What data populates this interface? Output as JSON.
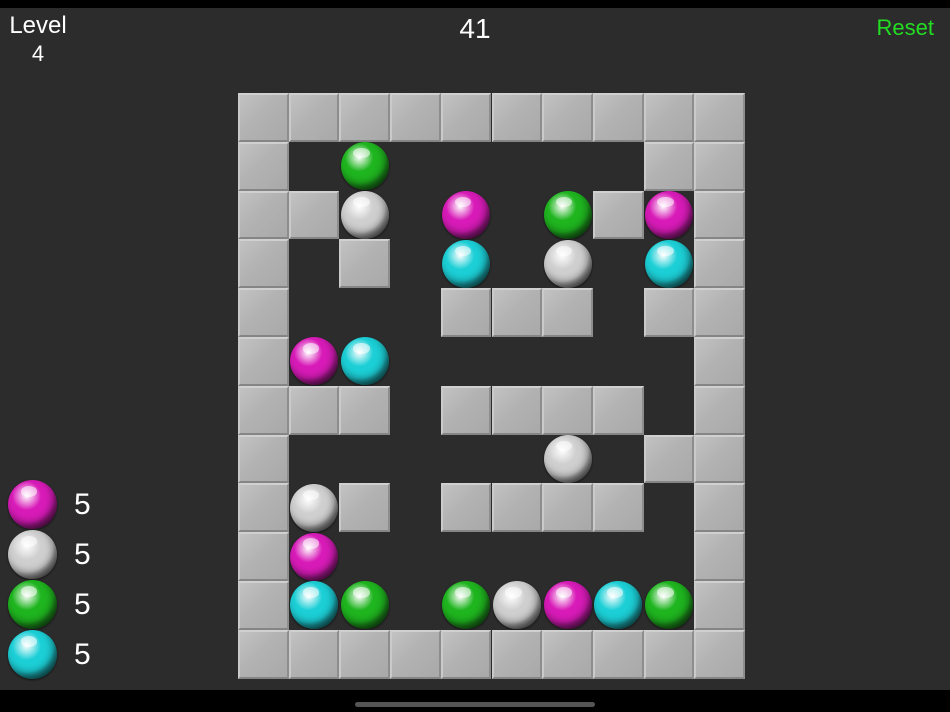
{
  "header": {
    "level_label": "Level",
    "level_value": "4",
    "moves": "41",
    "reset_label": "Reset"
  },
  "colors": {
    "background": "#2c2c2c",
    "reset": "#22dd22",
    "magenta": "#d81bb8",
    "white": "#cfcfcf",
    "green": "#1fb51f",
    "cyan": "#1ccfd6",
    "wall": "#b2b2b2"
  },
  "board": {
    "columns": 10,
    "rows": 12,
    "grid": [
      "##########",
      "#.G.....##",
      "##W.M.G#M#",
      "#.#.C.W.C#",
      "#...###.##",
      "#MC......#",
      "###.####.#",
      "#.....W.##",
      "#W#.####.#",
      "#M.......#",
      "#CG.GWMCG#",
      "##########"
    ],
    "legend": {
      "#": "wall",
      ".": "empty",
      "M": "magenta",
      "W": "white",
      "G": "green",
      "C": "cyan"
    }
  },
  "ball_counts": [
    {
      "color": "magenta",
      "count": "5"
    },
    {
      "color": "white",
      "count": "5"
    },
    {
      "color": "green",
      "count": "5"
    },
    {
      "color": "cyan",
      "count": "5"
    }
  ]
}
